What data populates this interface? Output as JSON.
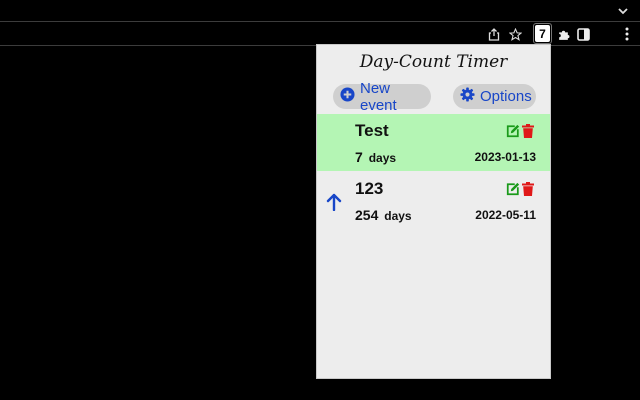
{
  "browser": {
    "tab_menu_icon": "chevron-down-icon",
    "toolbar_icons": [
      "share-icon",
      "bookmark-star-icon",
      "extensions-puzzle-icon",
      "side-panel-icon",
      "more-vert-icon"
    ],
    "extension_badge": "7"
  },
  "popup": {
    "title": "Day-Count Timer",
    "new_event_label": "New event",
    "options_label": "Options",
    "events": [
      {
        "name": "Test",
        "count": "7",
        "unit": "days",
        "date": "2023-01-13",
        "highlight": "#b4f5b4",
        "indicator": ""
      },
      {
        "name": "123",
        "count": "254",
        "unit": "days",
        "date": "2022-05-11",
        "highlight": "",
        "indicator": "arrow-up-icon"
      }
    ]
  },
  "colors": {
    "accent": "#1846c8",
    "edit": "#1a9a1a",
    "delete": "#e01818",
    "highlight": "#b4f5b4"
  }
}
